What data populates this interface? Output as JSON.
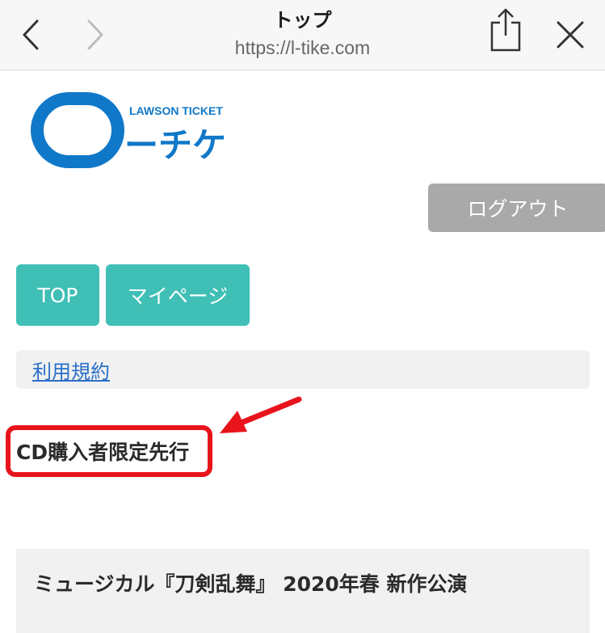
{
  "browser": {
    "title": "トップ",
    "url": "https://l-tike.com"
  },
  "logo": {
    "small_text": "LAWSON TICKET",
    "brand_text": "ーチケ",
    "brand_color": "#1078c8"
  },
  "header": {
    "logout_label": "ログアウト"
  },
  "nav": {
    "tabs": [
      {
        "label": "TOP"
      },
      {
        "label": "マイページ"
      }
    ]
  },
  "links": {
    "terms_label": "利用規約"
  },
  "main": {
    "section_heading": "CD購入者限定先行",
    "event_title": "ミュージカル『刀剣乱舞』 2020年春 新作公演"
  },
  "colors": {
    "accent": "#3fbfb6",
    "logout_bg": "#a9a9a9",
    "annotation_red": "#e8141b",
    "link": "#2a6fc9"
  }
}
